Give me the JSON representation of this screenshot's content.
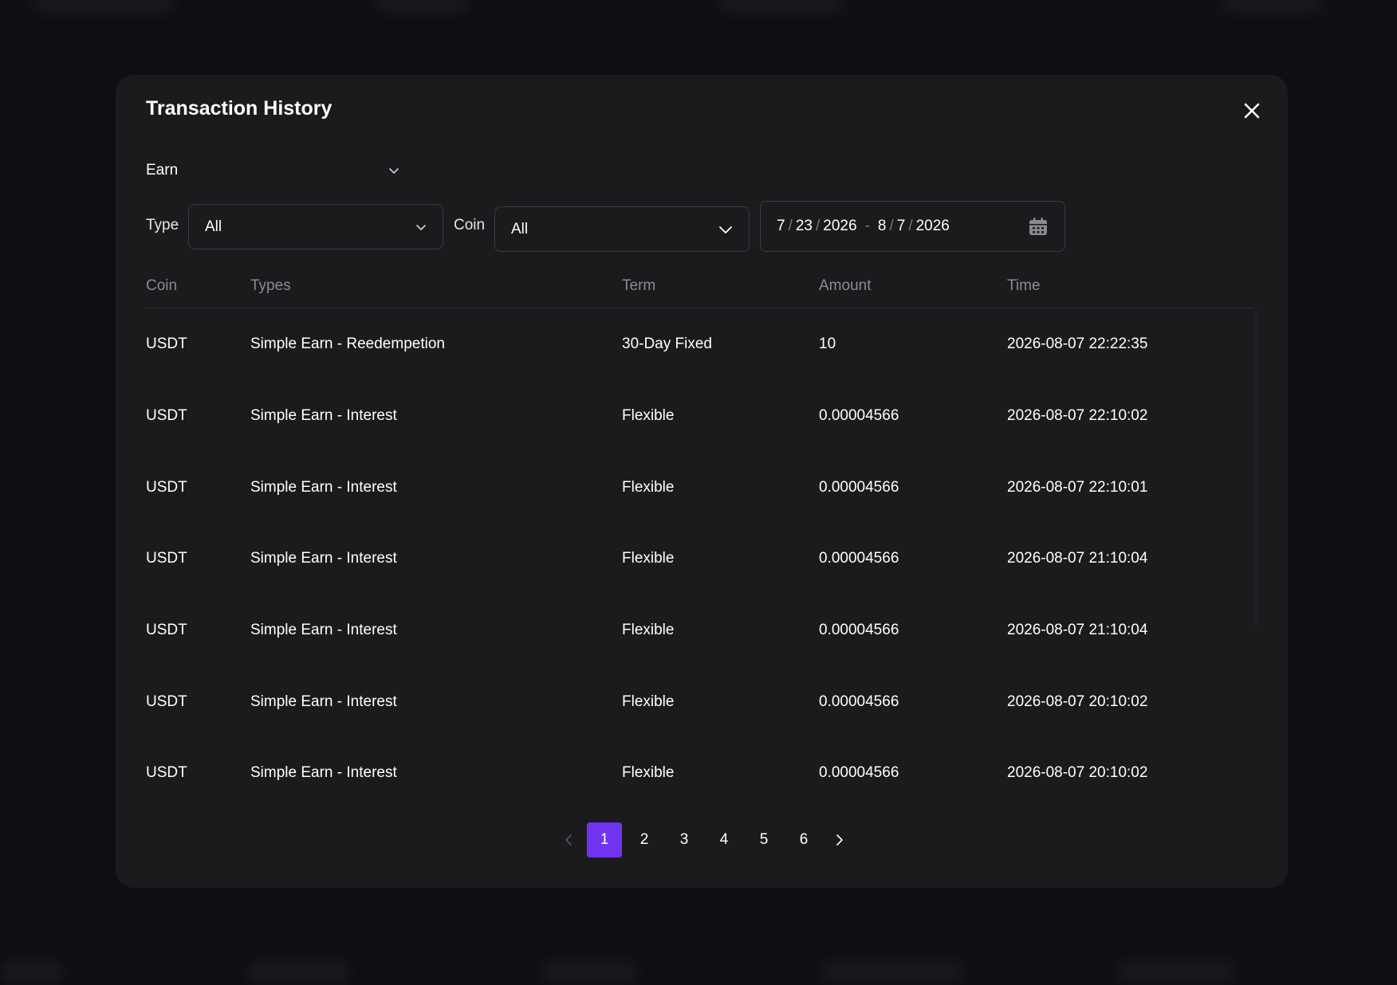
{
  "modal": {
    "title": "Transaction History"
  },
  "category": {
    "value": "Earn"
  },
  "filters": {
    "type_label": "Type",
    "type_value": "All",
    "coin_label": "Coin",
    "coin_value": "All",
    "date_range": {
      "start_month": "7",
      "start_day": "23",
      "start_year": "2026",
      "separator": "/",
      "dash": "-",
      "end_month": "8",
      "end_day": "7",
      "end_year": "2026"
    }
  },
  "table": {
    "columns": [
      "Coin",
      "Types",
      "Term",
      "Amount",
      "Time"
    ],
    "rows": [
      {
        "coin": "USDT",
        "type": "Simple Earn - Reedempetion",
        "term": "30-Day Fixed",
        "amount": "10",
        "time": "2026-08-07 22:22:35"
      },
      {
        "coin": "USDT",
        "type": "Simple Earn - Interest",
        "term": "Flexible",
        "amount": "0.00004566",
        "time": "2026-08-07 22:10:02"
      },
      {
        "coin": "USDT",
        "type": "Simple Earn - Interest",
        "term": "Flexible",
        "amount": "0.00004566",
        "time": "2026-08-07 22:10:01"
      },
      {
        "coin": "USDT",
        "type": "Simple Earn - Interest",
        "term": "Flexible",
        "amount": "0.00004566",
        "time": "2026-08-07 21:10:04"
      },
      {
        "coin": "USDT",
        "type": "Simple Earn - Interest",
        "term": "Flexible",
        "amount": "0.00004566",
        "time": "2026-08-07 21:10:04"
      },
      {
        "coin": "USDT",
        "type": "Simple Earn - Interest",
        "term": "Flexible",
        "amount": "0.00004566",
        "time": "2026-08-07 20:10:02"
      },
      {
        "coin": "USDT",
        "type": "Simple Earn - Interest",
        "term": "Flexible",
        "amount": "0.00004566",
        "time": "2026-08-07 20:10:02"
      }
    ]
  },
  "pagination": {
    "pages": [
      "1",
      "2",
      "3",
      "4",
      "5",
      "6"
    ],
    "current": "1"
  },
  "colors": {
    "modal_bg": "#1b1b1e",
    "page_bg": "#0f0f13",
    "accent": "#7034f0",
    "border": "#3a3a40",
    "muted_text": "#8a8a90"
  },
  "icons": {
    "close": "close-icon",
    "dropdown": "chevron-down-icon",
    "calendar": "calendar-icon",
    "prev": "chevron-left-icon",
    "next": "chevron-right-icon"
  }
}
